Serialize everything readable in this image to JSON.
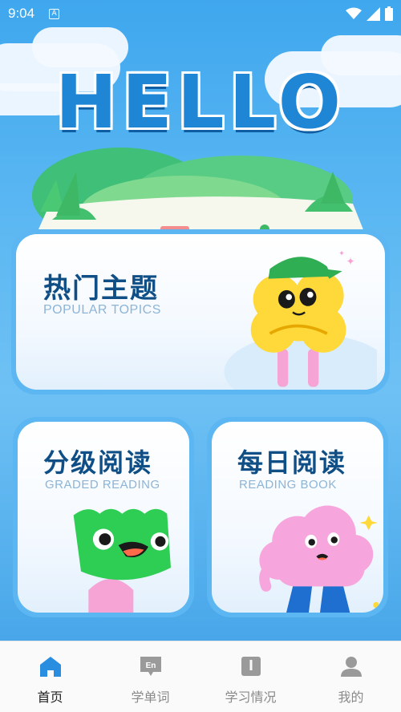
{
  "status_bar": {
    "time": "9:04",
    "notification_icon": "A"
  },
  "hero": {
    "title": "HELLO"
  },
  "cards": [
    {
      "title": "热门主题",
      "subtitle": "POPULAR TOPICS"
    },
    {
      "title": "分级阅读",
      "subtitle": "GRADED READING"
    },
    {
      "title": "每日阅读",
      "subtitle": "READING BOOK"
    }
  ],
  "bottom_nav": {
    "items": [
      {
        "label": "首页",
        "icon": "home-icon",
        "active": true
      },
      {
        "label": "学单词",
        "icon": "vocab-bubble-icon",
        "icon_text": "En"
      },
      {
        "label": "学习情况",
        "icon": "book-icon"
      },
      {
        "label": "我的",
        "icon": "user-icon"
      }
    ]
  },
  "colors": {
    "accent": "#1f86d6",
    "card_title": "#0f4f86",
    "nav_active": "#1f86d6"
  }
}
